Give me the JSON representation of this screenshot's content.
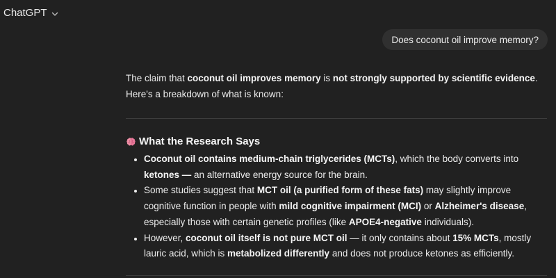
{
  "header": {
    "title": "ChatGPT",
    "chevron_icon": "chevron-down-icon"
  },
  "user_message": {
    "text": "Does coconut oil improve memory?"
  },
  "answer": {
    "intro": [
      {
        "text": "The claim that ",
        "bold": false
      },
      {
        "text": "coconut oil improves memory",
        "bold": true
      },
      {
        "text": " is ",
        "bold": false
      },
      {
        "text": "not strongly supported by scientific evidence",
        "bold": true
      },
      {
        "text": ". Here's a breakdown of what is known:",
        "bold": false
      }
    ],
    "section": {
      "emoji": "🧠",
      "emoji_icon": "brain-icon",
      "heading": "What the Research Says",
      "bullets": [
        [
          {
            "text": "Coconut oil contains medium-chain triglycerides (MCTs)",
            "bold": true
          },
          {
            "text": ", which the body converts into ",
            "bold": false
          },
          {
            "text": "ketones —",
            "bold": true
          },
          {
            "text": " an alternative energy source for the brain.",
            "bold": false
          }
        ],
        [
          {
            "text": "Some studies suggest that ",
            "bold": false
          },
          {
            "text": "MCT oil (a purified form of these fats)",
            "bold": true
          },
          {
            "text": " may slightly improve cognitive function in people with ",
            "bold": false
          },
          {
            "text": "mild cognitive impairment (MCI)",
            "bold": true
          },
          {
            "text": " or ",
            "bold": false
          },
          {
            "text": "Alzheimer's disease",
            "bold": true
          },
          {
            "text": ", especially those with certain genetic profiles (like ",
            "bold": false
          },
          {
            "text": "APOE4-negative",
            "bold": true
          },
          {
            "text": " individuals).",
            "bold": false
          }
        ],
        [
          {
            "text": "However, ",
            "bold": false
          },
          {
            "text": "coconut oil itself is not pure MCT oil",
            "bold": true
          },
          {
            "text": " — it only contains about ",
            "bold": false
          },
          {
            "text": "15% MCTs",
            "bold": true
          },
          {
            "text": ", mostly lauric acid, which is ",
            "bold": false
          },
          {
            "text": "metabolized differently",
            "bold": true
          },
          {
            "text": " and does not produce ketones as efficiently.",
            "bold": false
          }
        ]
      ]
    }
  },
  "colors": {
    "background": "#212121",
    "user_bubble": "#303030",
    "text": "#ececec",
    "divider": "#3d3d3d"
  }
}
